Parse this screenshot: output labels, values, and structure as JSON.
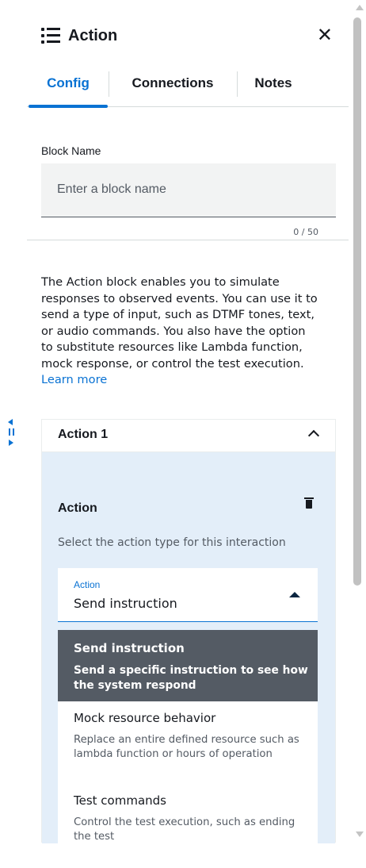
{
  "header": {
    "title": "Action",
    "close_label": "✕"
  },
  "tabs": [
    {
      "label": "Config",
      "active": true
    },
    {
      "label": "Connections",
      "active": false
    },
    {
      "label": "Notes",
      "active": false
    }
  ],
  "block_name": {
    "label": "Block Name",
    "placeholder": "Enter a block name",
    "value": "",
    "counter": "0 / 50"
  },
  "description": {
    "text": "The Action block enables you to simulate responses to observed events. You can use it to send a type of input, such as DTMF tones, text, or audio commands. You also have the option to substitute resources like Lambda function, mock response, or control the test execution.",
    "link": "Learn more"
  },
  "action_card": {
    "title": "Action 1",
    "section_title": "Action",
    "section_subtitle": "Select the action type for this interaction",
    "select": {
      "label": "Action",
      "value": "Send instruction"
    },
    "options": [
      {
        "title": "Send instruction",
        "description": "Send a specific instruction to see how the system respond",
        "selected": true
      },
      {
        "title": "Mock resource behavior",
        "description": "Replace an entire defined resource such as lambda function or hours of operation",
        "selected": false
      },
      {
        "title": "Test commands",
        "description": "Control the test execution, such as ending the test",
        "selected": false
      }
    ]
  },
  "colors": {
    "accent": "#0972d3",
    "selected_option_bg": "#545b64",
    "card_body_bg": "#e3eef9"
  },
  "icons": [
    "list-icon",
    "close-icon",
    "chevron-up-icon",
    "trash-icon",
    "caret-up-icon",
    "split-handle-icon"
  ]
}
